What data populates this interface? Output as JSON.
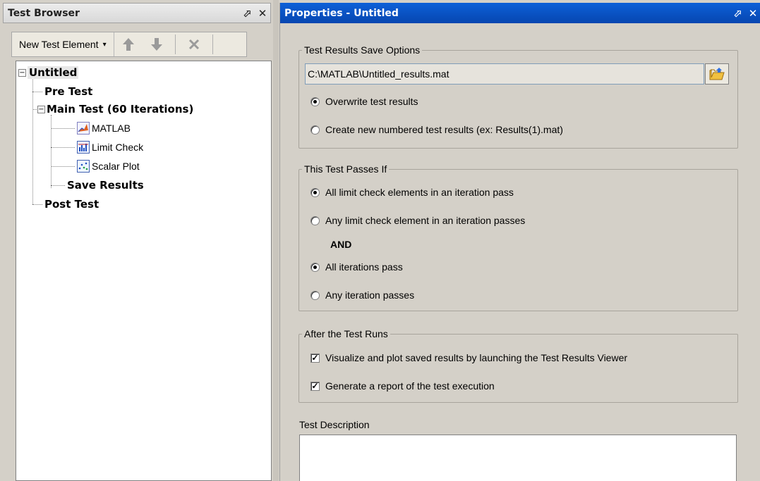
{
  "left_panel": {
    "title": "Test Browser",
    "pin_glyph": "⬀",
    "close_glyph": "✕",
    "toolbar": {
      "new_element_label": "New Test Element",
      "caret": "▾",
      "move_up_icon": "arrow-up-icon",
      "move_down_icon": "arrow-down-icon",
      "delete_icon": "delete-x-icon"
    },
    "tree": {
      "root": "Untitled",
      "root_expander": "−",
      "pre_test": "Pre Test",
      "main_test": "Main Test (60 Iterations)",
      "main_expander": "−",
      "children": [
        "MATLAB",
        "Limit Check",
        "Scalar Plot"
      ],
      "save_results": "Save Results",
      "post_test": "Post Test"
    }
  },
  "right_panel": {
    "title": "Properties - Untitled",
    "pin_glyph": "⬀",
    "close_glyph": "✕",
    "save_options": {
      "legend": "Test Results Save Options",
      "path": "C:\\MATLAB\\Untitled_results.mat",
      "overwrite_label": "Overwrite test results",
      "overwrite_checked": true,
      "numbered_label": "Create new numbered test results (ex: Results(1).mat)",
      "numbered_checked": false
    },
    "pass_criteria": {
      "legend": "This Test Passes If",
      "all_limit_label": "All limit check elements in an iteration pass",
      "all_limit_checked": true,
      "any_limit_label": "Any limit check element in an iteration passes",
      "any_limit_checked": false,
      "and_label": "AND",
      "all_iter_label": "All iterations pass",
      "all_iter_checked": true,
      "any_iter_label": "Any iteration passes",
      "any_iter_checked": false
    },
    "after_runs": {
      "legend": "After the Test Runs",
      "visualize_label": "Visualize and plot saved results by launching the Test Results Viewer",
      "visualize_checked": true,
      "report_label": "Generate a report of the test execution",
      "report_checked": true,
      "check_glyph": "✓"
    },
    "description": {
      "label": "Test Description",
      "value": ""
    }
  },
  "colors": {
    "active_title": "#0646b0",
    "inactive_title": "#e0e0e0",
    "panel_bg": "#d4d0c8"
  }
}
